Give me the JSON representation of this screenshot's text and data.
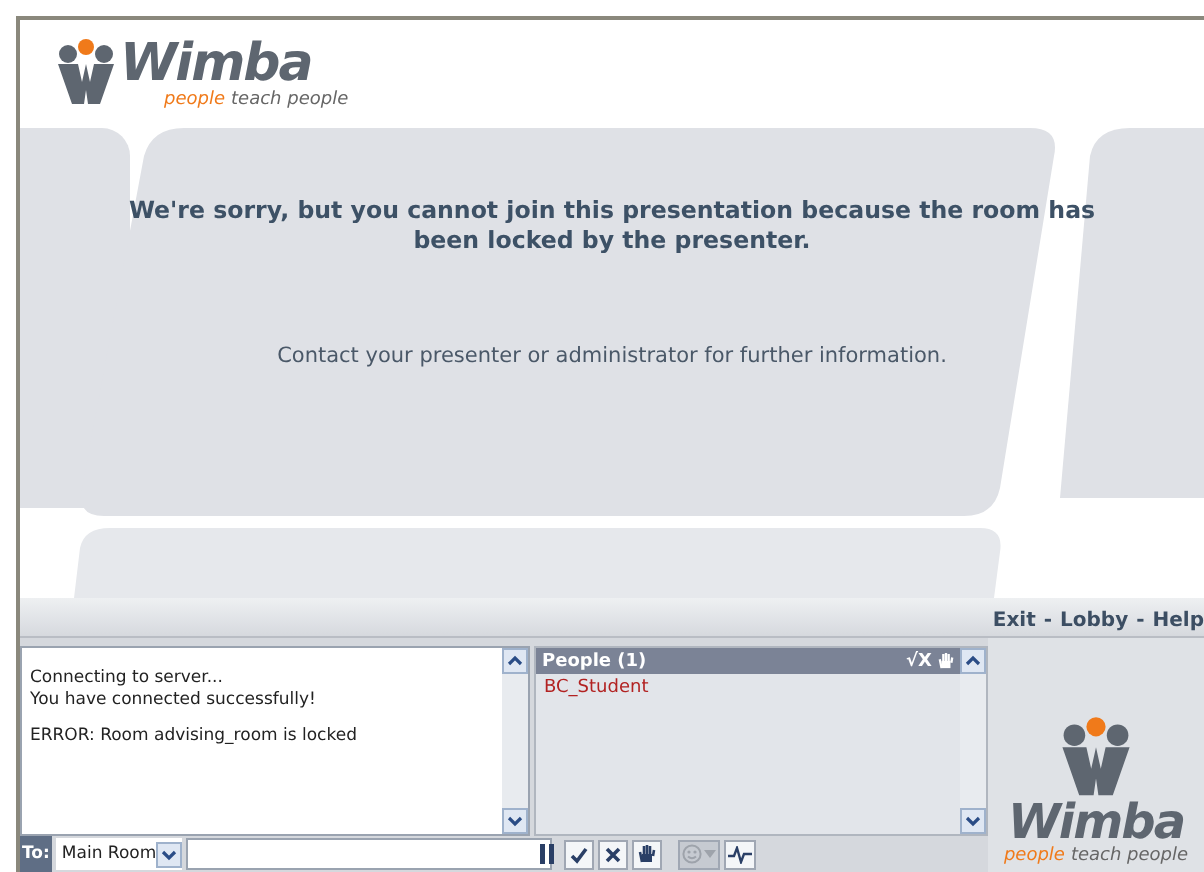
{
  "logo": {
    "name": "Wimba",
    "tagline_accent": "people",
    "tagline": "teach people"
  },
  "message": {
    "title": "We're sorry, but you cannot join this presentation because the room has been locked by the presenter.",
    "detail": "Contact your presenter or administrator for further information."
  },
  "nav": {
    "separator": "-",
    "links": [
      {
        "label": "Exit"
      },
      {
        "label": "Lobby"
      },
      {
        "label": "Help"
      }
    ]
  },
  "chat": {
    "lines": [
      {
        "kind": "info",
        "text": "Connecting to server..."
      },
      {
        "kind": "info",
        "text": "You have connected successfully!"
      },
      {
        "kind": "error",
        "text": "ERROR: Room advising_room is locked"
      }
    ],
    "to_label": "To:",
    "recipient": "Main Room"
  },
  "people": {
    "title": "People (1)",
    "header_marks": "√X",
    "members": [
      {
        "name": "BC_Student"
      }
    ]
  },
  "toolbar": [
    {
      "kind": "check",
      "disabled": false
    },
    {
      "kind": "cross",
      "disabled": false
    },
    {
      "kind": "hand",
      "disabled": false
    },
    {
      "kind": "emoticon",
      "disabled": true
    },
    {
      "kind": "pulse",
      "disabled": false
    }
  ],
  "side_logo": {
    "name": "Wimba",
    "tagline_accent": "people",
    "tagline": "teach people"
  }
}
